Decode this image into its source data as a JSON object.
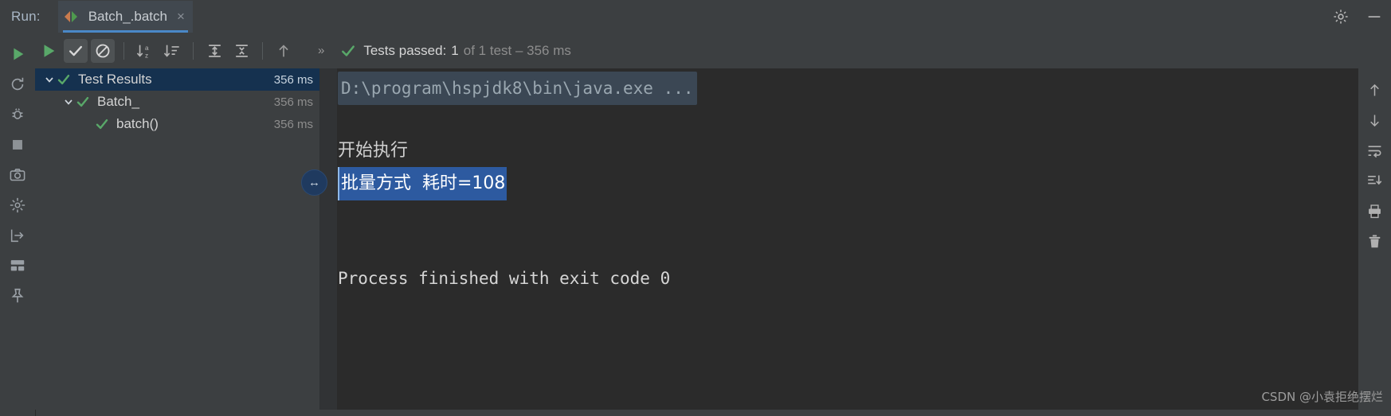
{
  "window": {
    "run_label": "Run:",
    "tab": {
      "title": "Batch_.batch",
      "close": "×",
      "icon": "run-config-icon"
    },
    "settings_icon": "gear-icon",
    "minimize_icon": "minimize-icon"
  },
  "left_tools": [
    {
      "name": "rerun-icon",
      "title": "Rerun"
    },
    {
      "name": "rerun-failed-icon",
      "title": "Rerun Failed Tests"
    },
    {
      "name": "debug-icon",
      "title": "Debug"
    },
    {
      "name": "stop-icon",
      "title": "Stop"
    },
    {
      "name": "camera-icon",
      "title": "Screenshot"
    },
    {
      "name": "profiler-icon",
      "title": "Profiler"
    },
    {
      "name": "import-icon",
      "title": "Import Tests"
    },
    {
      "name": "layout-icon",
      "title": "Layout"
    },
    {
      "name": "pin-icon",
      "title": "Pin Tab"
    }
  ],
  "test_toolbar": {
    "buttons": [
      {
        "name": "run-icon",
        "label": "Run",
        "pressed": false
      },
      {
        "name": "show-passed-icon",
        "label": "Show Passed",
        "pressed": true
      },
      {
        "name": "show-ignored-icon",
        "label": "Show Ignored",
        "pressed": true
      },
      {
        "name": "sort-alphabetically-icon",
        "label": "Sort Alphabetically",
        "pressed": false
      },
      {
        "name": "sort-by-duration-icon",
        "label": "Sort by Duration",
        "pressed": false
      },
      {
        "name": "expand-all-icon",
        "label": "Expand All",
        "pressed": false
      },
      {
        "name": "collapse-all-icon",
        "label": "Collapse All",
        "pressed": false
      },
      {
        "name": "previous-occurrence-icon",
        "label": "Previous Occurrence",
        "pressed": false
      }
    ],
    "overflow_icon": "chevrons-right-icon"
  },
  "status": {
    "icon": "check-icon",
    "prefix": "Tests passed:",
    "count": "1",
    "suffix": "of 1 test – 356 ms"
  },
  "tree": {
    "rows": [
      {
        "label": "Test Results",
        "time": "356 ms",
        "depth": 0,
        "expanded": true,
        "has_twisty": true,
        "selected": true,
        "status_icon": "check-icon"
      },
      {
        "label": "Batch_",
        "time": "356 ms",
        "depth": 1,
        "expanded": true,
        "has_twisty": true,
        "selected": false,
        "status_icon": "check-icon"
      },
      {
        "label": "batch()",
        "time": "356 ms",
        "depth": 2,
        "expanded": false,
        "has_twisty": false,
        "selected": false,
        "status_icon": "check-icon"
      }
    ]
  },
  "console": {
    "lines": [
      {
        "kind": "folded",
        "text": "D:\\program\\hspjdk8\\bin\\java.exe ..."
      },
      {
        "kind": "blank",
        "text": ""
      },
      {
        "kind": "cjk",
        "text": "开始执行"
      },
      {
        "kind": "selected",
        "text": "批量方式  耗时=108"
      },
      {
        "kind": "blank",
        "text": ""
      },
      {
        "kind": "blank",
        "text": ""
      },
      {
        "kind": "mono",
        "text": "Process finished with exit code 0"
      }
    ]
  },
  "drag_handle": {
    "icon": "horizontal-resize-icon",
    "glyph": "↔"
  },
  "right_tools": [
    {
      "name": "up-arrow-icon",
      "title": "Up"
    },
    {
      "name": "down-arrow-icon",
      "title": "Down"
    },
    {
      "name": "soft-wrap-icon",
      "title": "Soft-Wrap"
    },
    {
      "name": "scroll-to-end-icon",
      "title": "Scroll to End"
    },
    {
      "name": "print-icon",
      "title": "Print"
    },
    {
      "name": "trash-icon",
      "title": "Clear All"
    }
  ],
  "watermark": {
    "text": "CSDN @小袁拒绝摆烂"
  },
  "colors": {
    "background": "#3c3f41",
    "console_background": "#2b2b2b",
    "accent_blue": "#4a88c7",
    "selection_blue": "#2d5aa0",
    "tree_selection": "#15314f",
    "pass_green": "#59a869",
    "text": "#bbbbbb"
  }
}
